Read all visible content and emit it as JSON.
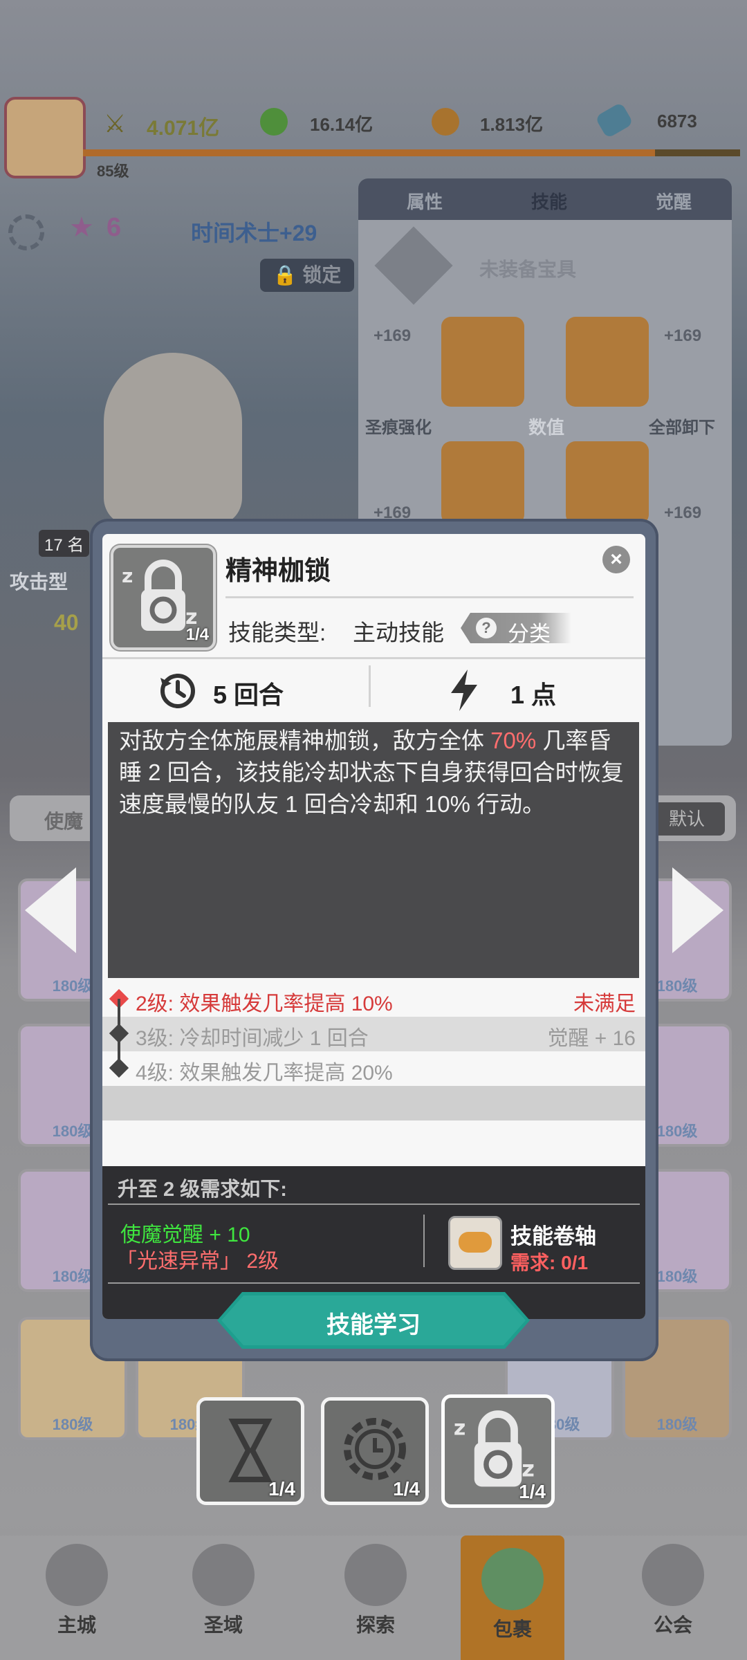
{
  "topbar": {
    "level": "85级",
    "power": "4.071亿",
    "green_res": "16.14亿",
    "orange_res": "1.813亿",
    "gem": "6873"
  },
  "hero_panel": {
    "stars": "6",
    "title": "时间术士+29",
    "lock": "锁定",
    "tabs": [
      "属性",
      "技能",
      "觉醒"
    ],
    "equip_slot": "未装备宝具",
    "stat_values": [
      "+169",
      "+169",
      "+169",
      "+169"
    ],
    "holy_strengthen": "圣痕强化",
    "unload_all": "全部卸下",
    "center_label": "数值",
    "rank": "17 名",
    "type": "攻击型",
    "power_short": "40",
    "filter": "使魔",
    "sort_default": "默认"
  },
  "hero_cards": [
    "180级",
    "180级",
    "180级",
    "180级",
    "180级",
    "180级",
    "180级",
    "180级",
    "180级",
    "180级"
  ],
  "bottom_nav": [
    {
      "label": "主城",
      "icon": "castle-icon"
    },
    {
      "label": "圣域",
      "icon": "vortex-icon"
    },
    {
      "label": "探索",
      "icon": "sword-icon"
    },
    {
      "label": "包裹",
      "icon": "bag-icon"
    },
    {
      "label": "公会",
      "icon": "guild-icon"
    }
  ],
  "skill": {
    "name": "精神枷锁",
    "level_badge": "1/4",
    "type_label": "技能类型:",
    "type_value": "主动技能",
    "category_label": "分类",
    "cooldown": "5 回合",
    "cost": "1 点",
    "desc_part1": "对敌方全体施展精神枷锁，敌方全体 ",
    "desc_highlight": "70%",
    "desc_part2": " 几率昏睡 2 回合，该技能冷却状态下自身获得回合时恢复速度最慢的队友 1 回合冷却和 10% 行动。",
    "levels": [
      {
        "text": "2级:  效果触发几率提高 10%",
        "status": "未满足"
      },
      {
        "text": "3级:  冷却时间减少 1 回合",
        "status": "觉醒 + 16"
      },
      {
        "text": "4级:  效果触发几率提高 20%",
        "status": ""
      }
    ],
    "requirement_title": "升至 2 级需求如下:",
    "req_awaken": "使魔觉醒 + 10",
    "req_skill": "「光速异常」 2级",
    "item_name": "技能卷轴",
    "item_need": "需求: 0/1",
    "learn_button": "技能学习"
  },
  "skill_thumbs": [
    {
      "badge": "1/4",
      "icon": "hourglass-icon"
    },
    {
      "badge": "1/4",
      "icon": "clock-gear-icon"
    },
    {
      "badge": "1/4",
      "icon": "sleep-lock-icon"
    }
  ],
  "colors": {
    "accent_red": "#e84a4a",
    "accent_green": "#3fe63f",
    "teal_button": "#1e9e8e",
    "modal_frame": "#5f6b80"
  }
}
